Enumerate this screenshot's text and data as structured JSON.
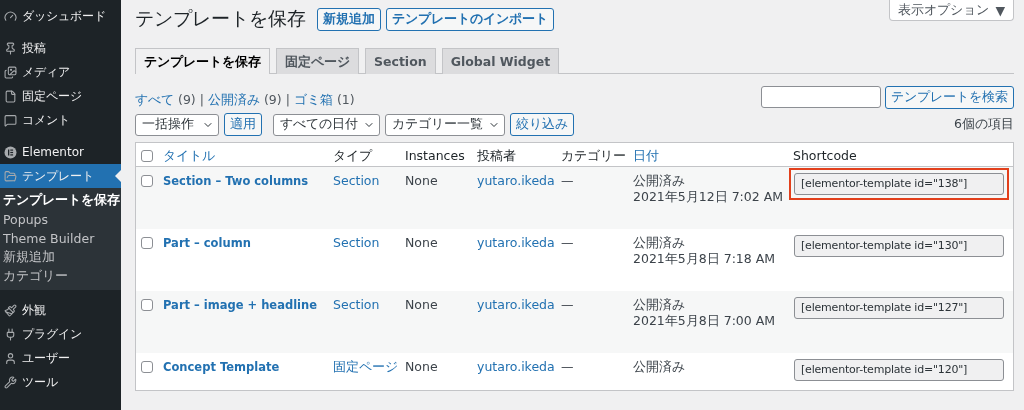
{
  "sidebar": {
    "groups": [
      {
        "items": [
          {
            "label": "ダッシュボード",
            "selected": false
          }
        ]
      },
      {
        "items": [
          {
            "label": "投稿",
            "selected": false
          },
          {
            "label": "メディア",
            "selected": false
          },
          {
            "label": "固定ページ",
            "selected": false
          },
          {
            "label": "コメント",
            "selected": false
          }
        ]
      },
      {
        "items": [
          {
            "label": "Elementor",
            "selected": false
          },
          {
            "label": "テンプレート",
            "selected": true,
            "children": [
              {
                "label": "テンプレートを保存",
                "selected": true
              },
              {
                "label": "Popups",
                "selected": false
              },
              {
                "label": "Theme Builder",
                "selected": false
              },
              {
                "label": "新規追加",
                "selected": false
              },
              {
                "label": "カテゴリー",
                "selected": false
              }
            ]
          }
        ]
      },
      {
        "items": [
          {
            "label": "外観",
            "selected": false
          },
          {
            "label": "プラグイン",
            "selected": false
          },
          {
            "label": "ユーザー",
            "selected": false
          },
          {
            "label": "ツール",
            "selected": false
          }
        ]
      }
    ]
  },
  "screen_options": "表示オプション",
  "screen_options_caret": "▼",
  "page_title": "テンプレートを保存",
  "title_buttons": [
    "新規追加",
    "テンプレートのインポート"
  ],
  "tabs": [
    {
      "label": "テンプレートを保存",
      "selected": true
    },
    {
      "label": "固定ページ",
      "selected": false
    },
    {
      "label": "Section",
      "selected": false
    },
    {
      "label": "Global Widget",
      "selected": false
    }
  ],
  "filters": [
    {
      "label": "すべて",
      "count": "(9)"
    },
    {
      "label": "公開済み",
      "count": "(9)"
    },
    {
      "label": "ゴミ箱",
      "count": "(1)"
    }
  ],
  "filter_separator": "|",
  "search": {
    "button": "テンプレートを検索"
  },
  "bulk_action": {
    "select": "一括操作",
    "button": "適用"
  },
  "date_select": "すべての日付",
  "category_select": "カテゴリー一覧",
  "filter_button": "絞り込み",
  "item_count": "6個の項目",
  "table": {
    "select_all_checked": false,
    "columns": [
      {
        "label": "タイトル",
        "sortable": true
      },
      {
        "label": "タイプ",
        "sortable": false
      },
      {
        "label": "Instances",
        "sortable": false
      },
      {
        "label": "投稿者",
        "sortable": false
      },
      {
        "label": "カテゴリー",
        "sortable": false
      },
      {
        "label": "日付",
        "sortable": true
      },
      {
        "label": "Shortcode",
        "sortable": false
      }
    ],
    "rows": [
      {
        "title": "Section – Two columns",
        "type": "Section",
        "instances": "None",
        "author": "yutaro.ikeda",
        "category": "—",
        "status": "公開済み",
        "date": "2021年5月12日 7:02 AM",
        "shortcode": "[elementor-template id=\"138\"]",
        "highlighted": true,
        "checked": false
      },
      {
        "title": "Part – column",
        "type": "Section",
        "instances": "None",
        "author": "yutaro.ikeda",
        "category": "—",
        "status": "公開済み",
        "date": "2021年5月8日 7:18 AM",
        "shortcode": "[elementor-template id=\"130\"]",
        "highlighted": false,
        "checked": false
      },
      {
        "title": "Part – image + headline",
        "type": "Section",
        "instances": "None",
        "author": "yutaro.ikeda",
        "category": "—",
        "status": "公開済み",
        "date": "2021年5月8日 7:00 AM",
        "shortcode": "[elementor-template id=\"127\"]",
        "highlighted": false,
        "checked": false
      },
      {
        "title": "Concept Template",
        "type": "固定ページ",
        "instances": "None",
        "author": "yutaro.ikeda",
        "category": "—",
        "status": "公開済み",
        "shortcode": "[elementor-template id=\"120\"]",
        "highlighted": false,
        "checked": false
      }
    ]
  }
}
